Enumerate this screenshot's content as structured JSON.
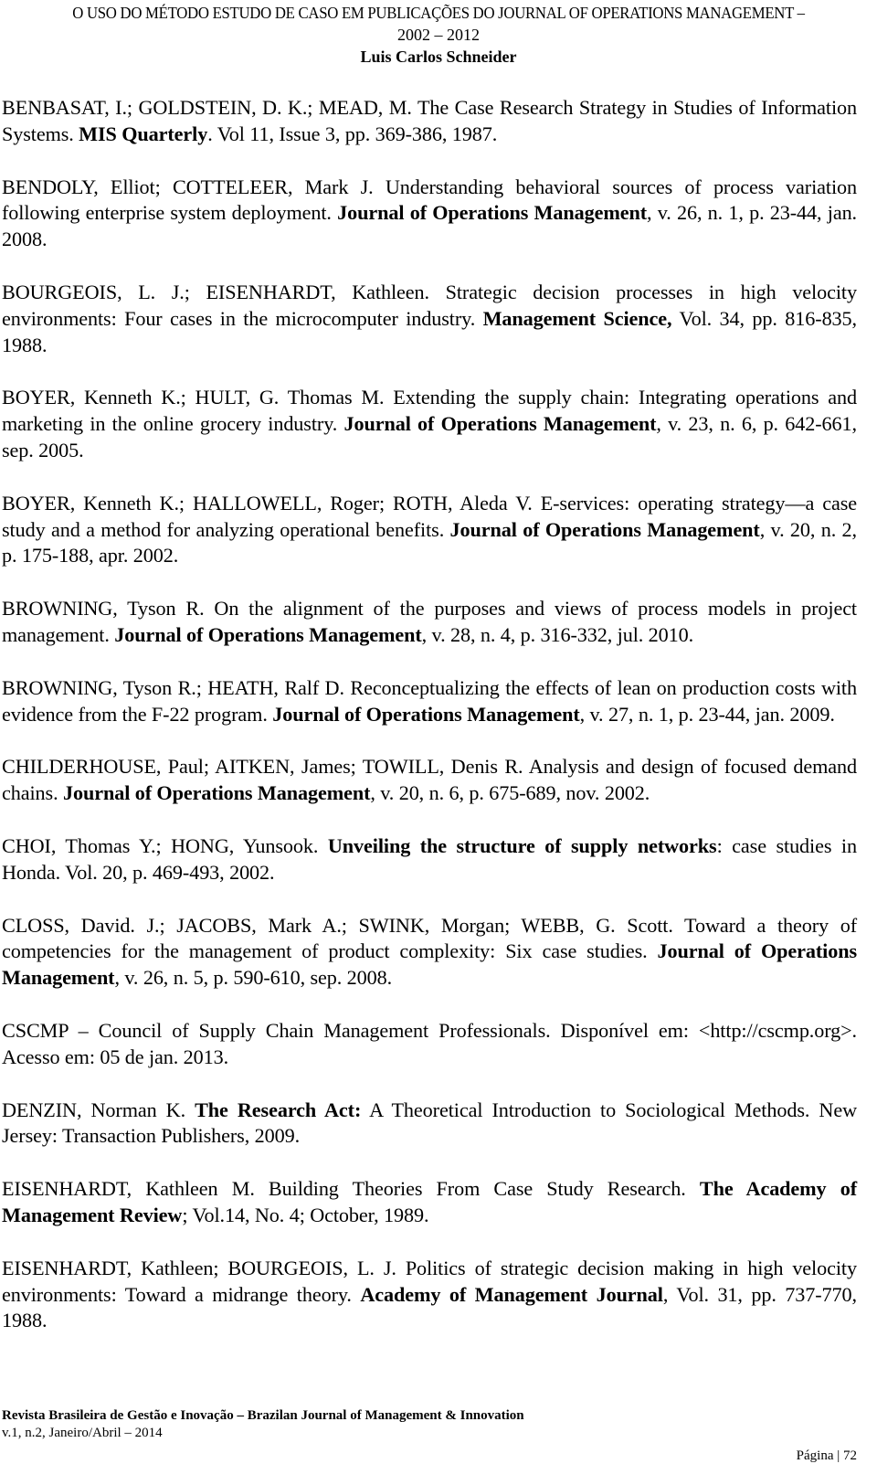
{
  "header": {
    "title": "O USO DO MÉTODO ESTUDO DE CASO EM PUBLICAÇÕES DO JOURNAL OF OPERATIONS MANAGEMENT –",
    "years": "2002 – 2012",
    "author": "Luis Carlos Schneider"
  },
  "references": [
    {
      "parts": [
        {
          "t": "BENBASAT, I.; GOLDSTEIN, D. K.; MEAD, M. The Case Research Strategy in Studies of Information Systems. "
        },
        {
          "t": "MIS Quarterly",
          "b": true
        },
        {
          "t": ". Vol 11, Issue 3, pp. 369-386, 1987."
        }
      ]
    },
    {
      "parts": [
        {
          "t": "BENDOLY, Elliot; COTTELEER, Mark J. Understanding behavioral sources of process variation following enterprise system deployment. "
        },
        {
          "t": "Journal of Operations Management",
          "b": true
        },
        {
          "t": ", v. 26, n. 1, p. 23-44, jan. 2008."
        }
      ]
    },
    {
      "parts": [
        {
          "t": "BOURGEOIS, L. J.; EISENHARDT, Kathleen. Strategic decision processes in high velocity environments: Four cases in the microcomputer industry. "
        },
        {
          "t": "Management Science,",
          "b": true
        },
        {
          "t": " Vol. 34, pp. 816-835, 1988."
        }
      ]
    },
    {
      "parts": [
        {
          "t": "BOYER, Kenneth K.; HULT, G. Thomas M. Extending the supply chain: Integrating operations and marketing in the online grocery industry. "
        },
        {
          "t": "Journal of Operations Management",
          "b": true
        },
        {
          "t": ", v. 23, n. 6, p. 642-661, sep. 2005."
        }
      ]
    },
    {
      "parts": [
        {
          "t": "BOYER, Kenneth K.; HALLOWELL, Roger; ROTH, Aleda V. E-services: operating strategy—a case study and a method for analyzing operational benefits. "
        },
        {
          "t": "Journal of Operations Management",
          "b": true
        },
        {
          "t": ", v. 20, n. 2, p. 175-188, apr. 2002."
        }
      ]
    },
    {
      "parts": [
        {
          "t": "BROWNING, Tyson R. On the alignment of the purposes and views of process models in project management. "
        },
        {
          "t": "Journal of Operations Management",
          "b": true
        },
        {
          "t": ", v. 28, n. 4, p. 316-332, jul. 2010."
        }
      ]
    },
    {
      "parts": [
        {
          "t": "BROWNING, Tyson R.; HEATH, Ralf D. Reconceptualizing the effects of lean on production costs with evidence from the F-22 program. "
        },
        {
          "t": "Journal of Operations Management",
          "b": true
        },
        {
          "t": ", v. 27, n. 1, p. 23-44, jan. 2009."
        }
      ]
    },
    {
      "parts": [
        {
          "t": "CHILDERHOUSE, Paul; AITKEN, James; TOWILL, Denis R. Analysis and design of focused demand chains. "
        },
        {
          "t": "Journal of Operations Management",
          "b": true
        },
        {
          "t": ", v. 20, n. 6, p. 675-689, nov. 2002."
        }
      ]
    },
    {
      "parts": [
        {
          "t": "CHOI, Thomas Y.; HONG, Yunsook. "
        },
        {
          "t": "Unveiling the structure of supply networks",
          "b": true
        },
        {
          "t": ": case studies in Honda. Vol. 20, p. 469-493, 2002."
        }
      ]
    },
    {
      "parts": [
        {
          "t": "CLOSS, David. J.; JACOBS, Mark A.; SWINK, Morgan; WEBB, G. Scott. Toward a theory of competencies for the management of product complexity: Six case studies. "
        },
        {
          "t": "Journal of Operations Management",
          "b": true
        },
        {
          "t": ", v. 26, n. 5, p. 590-610, sep. 2008."
        }
      ]
    },
    {
      "parts": [
        {
          "t": "CSCMP – Council of Supply Chain Management Professionals. Disponível em: <http://cscmp.org>. Acesso em: 05 de jan. 2013."
        }
      ]
    },
    {
      "parts": [
        {
          "t": "DENZIN, Norman K. "
        },
        {
          "t": "The Research Act:",
          "b": true
        },
        {
          "t": " A Theoretical Introduction to Sociological Methods. New Jersey: Transaction Publishers, 2009."
        }
      ]
    },
    {
      "parts": [
        {
          "t": "EISENHARDT, Kathleen M. Building Theories From Case Study Research. "
        },
        {
          "t": "The Academy of Management Review",
          "b": true
        },
        {
          "t": "; Vol.14, No. 4; October, 1989."
        }
      ]
    },
    {
      "parts": [
        {
          "t": "EISENHARDT, Kathleen; BOURGEOIS, L. J. Politics of strategic decision making in high velocity environments: Toward a midrange theory. "
        },
        {
          "t": "Academy of Management Journal",
          "b": true
        },
        {
          "t": ", Vol. 31, pp. 737-770, 1988."
        }
      ]
    }
  ],
  "footer": {
    "journal": "Revista Brasileira de Gestão e Inovação – Brazilan Journal of Management & Innovation",
    "issue": "v.1, n.2, Janeiro/Abril – 2014",
    "page_label": "Página | 72"
  }
}
